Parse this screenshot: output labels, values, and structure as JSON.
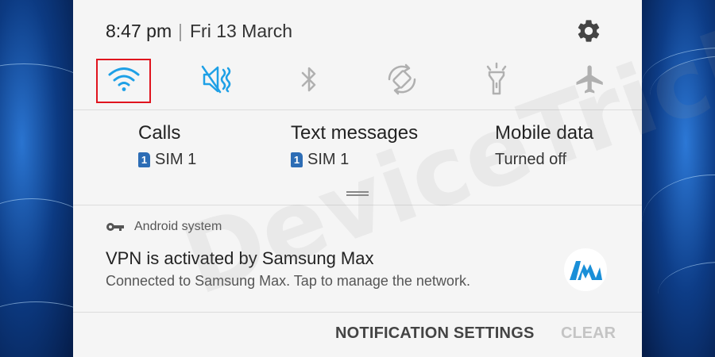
{
  "status_bar": {
    "time": "8:47 pm",
    "separator": "|",
    "date": "Fri 13 March"
  },
  "quick_toggles": [
    {
      "icon": "wifi-icon",
      "active": true,
      "highlighted": true
    },
    {
      "icon": "mute-icon",
      "active": true
    },
    {
      "icon": "bluetooth-icon",
      "active": false
    },
    {
      "icon": "auto-rotate-icon",
      "active": false
    },
    {
      "icon": "flashlight-icon",
      "active": false
    },
    {
      "icon": "airplane-icon",
      "active": false
    }
  ],
  "sim_settings": [
    {
      "title": "Calls",
      "badge": "1",
      "value": "SIM 1"
    },
    {
      "title": "Text messages",
      "badge": "1",
      "value": "SIM 1"
    },
    {
      "title": "Mobile data",
      "value": "Turned off"
    }
  ],
  "notification": {
    "app_name": "Android system",
    "title": "VPN is activated by Samsung Max",
    "body": "Connected to Samsung Max. Tap to manage the network."
  },
  "footer": {
    "settings_label": "NOTIFICATION SETTINGS",
    "clear_label": "CLEAR"
  },
  "watermark": "DeviceTricks",
  "colors": {
    "accent": "#1ea0e6",
    "inactive": "#b0b0b0",
    "highlight_border": "#e0141e",
    "sim_badge": "#2d6db5"
  }
}
